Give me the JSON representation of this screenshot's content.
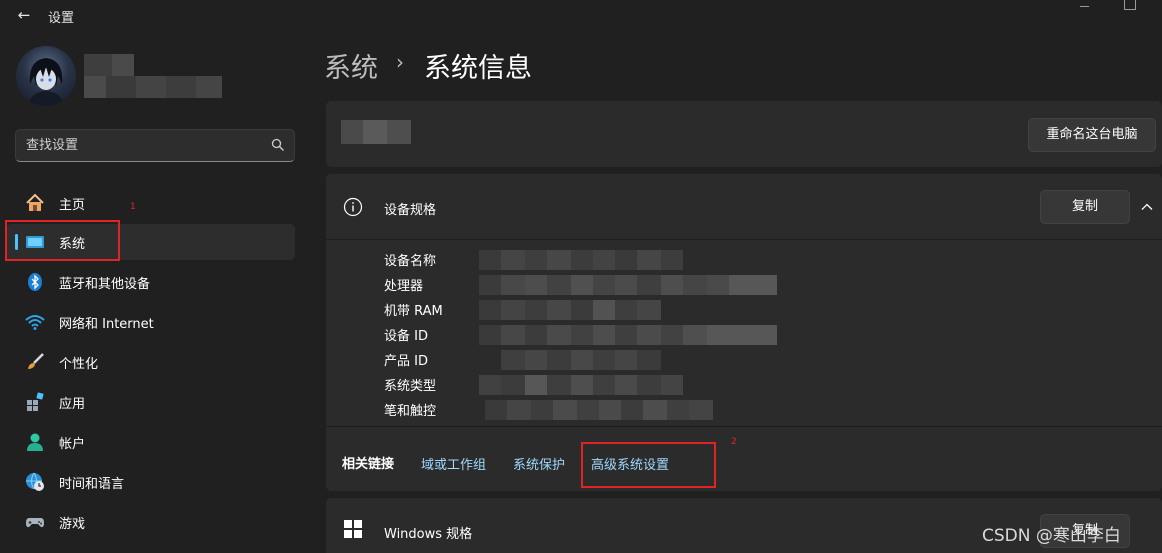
{
  "window": {
    "title": "设置",
    "back_glyph": "←"
  },
  "search": {
    "placeholder": "查找设置"
  },
  "sidebar": {
    "items": [
      {
        "label": "主页",
        "icon": "home-icon"
      },
      {
        "label": "系统",
        "icon": "system-monitor-icon"
      },
      {
        "label": "蓝牙和其他设备",
        "icon": "bluetooth-icon"
      },
      {
        "label": "网络和 Internet",
        "icon": "wifi-icon"
      },
      {
        "label": "个性化",
        "icon": "brush-icon"
      },
      {
        "label": "应用",
        "icon": "apps-icon"
      },
      {
        "label": "帐户",
        "icon": "account-icon"
      },
      {
        "label": "时间和语言",
        "icon": "globe-clock-icon"
      },
      {
        "label": "游戏",
        "icon": "gamepad-icon"
      }
    ],
    "active_index": 1
  },
  "annotations": {
    "marker_1": "1",
    "marker_2": "2"
  },
  "breadcrumb": {
    "parent": "系统",
    "separator": "›",
    "current": "系统信息"
  },
  "pc_card": {
    "rename_button": "重命名这台电脑"
  },
  "device_specs": {
    "title": "设备规格",
    "copy_button": "复制",
    "rows": [
      {
        "label": "设备名称"
      },
      {
        "label": "处理器"
      },
      {
        "label": "机带 RAM"
      },
      {
        "label": "设备 ID"
      },
      {
        "label": "产品 ID"
      },
      {
        "label": "系统类型"
      },
      {
        "label": "笔和触控"
      }
    ]
  },
  "related_links": {
    "title": "相关链接",
    "links": [
      "域或工作组",
      "系统保护",
      "高级系统设置"
    ]
  },
  "windows_specs": {
    "title": "Windows 规格",
    "copy_button": "复制"
  },
  "watermark": "CSDN @寒山李白",
  "colors": {
    "background": "#202020",
    "card": "#2b2b2b",
    "accent": "#4cc2ff",
    "link": "#9fd8ff",
    "highlight": "#e02424"
  }
}
